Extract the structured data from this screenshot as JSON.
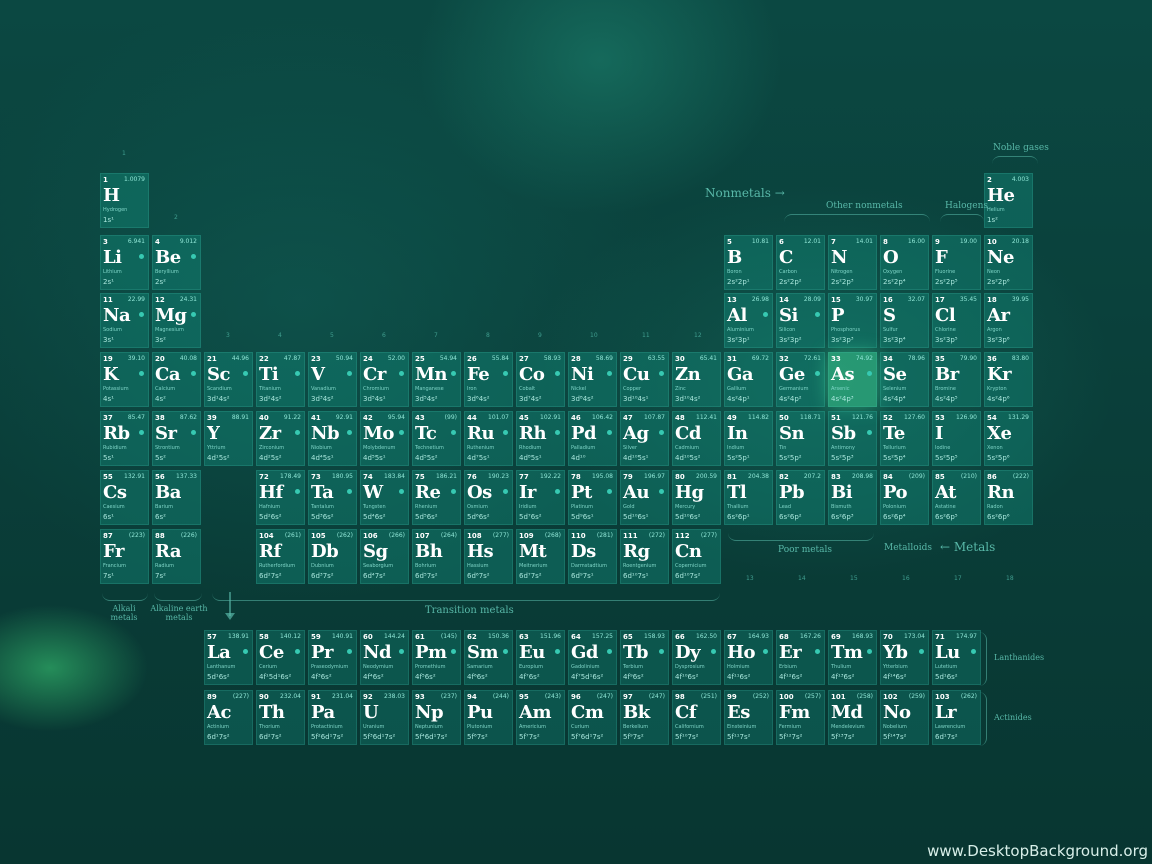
{
  "labels": {
    "nonmetals": "Nonmetals →",
    "other_nonmetals": "Other nonmetals",
    "halogens": "Halogens",
    "noble_gases": "Noble gases",
    "transition_metals": "Transition metals",
    "alkali_metals": "Alkali metals",
    "alkaline_earth_metals": "Alkaline earth metals",
    "poor_metals": "Poor metals",
    "metalloids": "Metalloids",
    "metals": "← Metals",
    "lanthanides": "Lanthanides",
    "actinides": "Actinides"
  },
  "watermark": "www.DesktopBackground.org",
  "elements": [
    {
      "n": "1",
      "s": "H",
      "name": "Hydrogen",
      "m": "1.0079",
      "c": "1s¹",
      "col": 1,
      "row": 1
    },
    {
      "n": "2",
      "s": "He",
      "name": "Helium",
      "m": "4.003",
      "c": "1s²",
      "col": 18,
      "row": 1
    },
    {
      "n": "3",
      "s": "Li",
      "name": "Lithium",
      "m": "6.941",
      "c": "2s¹",
      "col": 1,
      "row": 2
    },
    {
      "n": "4",
      "s": "Be",
      "name": "Beryllium",
      "m": "9.012",
      "c": "2s²",
      "col": 2,
      "row": 2
    },
    {
      "n": "5",
      "s": "B",
      "name": "Boron",
      "m": "10.81",
      "c": "2s²2p¹",
      "col": 13,
      "row": 2
    },
    {
      "n": "6",
      "s": "C",
      "name": "Carbon",
      "m": "12.01",
      "c": "2s²2p²",
      "col": 14,
      "row": 2
    },
    {
      "n": "7",
      "s": "N",
      "name": "Nitrogen",
      "m": "14.01",
      "c": "2s²2p³",
      "col": 15,
      "row": 2
    },
    {
      "n": "8",
      "s": "O",
      "name": "Oxygen",
      "m": "16.00",
      "c": "2s²2p⁴",
      "col": 16,
      "row": 2
    },
    {
      "n": "9",
      "s": "F",
      "name": "Fluorine",
      "m": "19.00",
      "c": "2s²2p⁵",
      "col": 17,
      "row": 2
    },
    {
      "n": "10",
      "s": "Ne",
      "name": "Neon",
      "m": "20.18",
      "c": "2s²2p⁶",
      "col": 18,
      "row": 2
    },
    {
      "n": "11",
      "s": "Na",
      "name": "Sodium",
      "m": "22.99",
      "c": "3s¹",
      "col": 1,
      "row": 3
    },
    {
      "n": "12",
      "s": "Mg",
      "name": "Magnesium",
      "m": "24.31",
      "c": "3s²",
      "col": 2,
      "row": 3
    },
    {
      "n": "13",
      "s": "Al",
      "name": "Aluminium",
      "m": "26.98",
      "c": "3s²3p¹",
      "col": 13,
      "row": 3
    },
    {
      "n": "14",
      "s": "Si",
      "name": "Silicon",
      "m": "28.09",
      "c": "3s²3p²",
      "col": 14,
      "row": 3
    },
    {
      "n": "15",
      "s": "P",
      "name": "Phosphorus",
      "m": "30.97",
      "c": "3s²3p³",
      "col": 15,
      "row": 3
    },
    {
      "n": "16",
      "s": "S",
      "name": "Sulfur",
      "m": "32.07",
      "c": "3s²3p⁴",
      "col": 16,
      "row": 3
    },
    {
      "n": "17",
      "s": "Cl",
      "name": "Chlorine",
      "m": "35.45",
      "c": "3s²3p⁵",
      "col": 17,
      "row": 3
    },
    {
      "n": "18",
      "s": "Ar",
      "name": "Argon",
      "m": "39.95",
      "c": "3s²3p⁶",
      "col": 18,
      "row": 3
    },
    {
      "n": "19",
      "s": "K",
      "name": "Potassium",
      "m": "39.10",
      "c": "4s¹",
      "col": 1,
      "row": 4
    },
    {
      "n": "20",
      "s": "Ca",
      "name": "Calcium",
      "m": "40.08",
      "c": "4s²",
      "col": 2,
      "row": 4
    },
    {
      "n": "21",
      "s": "Sc",
      "name": "Scandium",
      "m": "44.96",
      "c": "3d¹4s²",
      "col": 3,
      "row": 4
    },
    {
      "n": "22",
      "s": "Ti",
      "name": "Titanium",
      "m": "47.87",
      "c": "3d²4s²",
      "col": 4,
      "row": 4
    },
    {
      "n": "23",
      "s": "V",
      "name": "Vanadium",
      "m": "50.94",
      "c": "3d³4s²",
      "col": 5,
      "row": 4
    },
    {
      "n": "24",
      "s": "Cr",
      "name": "Chromium",
      "m": "52.00",
      "c": "3d⁵4s¹",
      "col": 6,
      "row": 4
    },
    {
      "n": "25",
      "s": "Mn",
      "name": "Manganese",
      "m": "54.94",
      "c": "3d⁵4s²",
      "col": 7,
      "row": 4
    },
    {
      "n": "26",
      "s": "Fe",
      "name": "Iron",
      "m": "55.84",
      "c": "3d⁶4s²",
      "col": 8,
      "row": 4
    },
    {
      "n": "27",
      "s": "Co",
      "name": "Cobalt",
      "m": "58.93",
      "c": "3d⁷4s²",
      "col": 9,
      "row": 4
    },
    {
      "n": "28",
      "s": "Ni",
      "name": "Nickel",
      "m": "58.69",
      "c": "3d⁸4s²",
      "col": 10,
      "row": 4
    },
    {
      "n": "29",
      "s": "Cu",
      "name": "Copper",
      "m": "63.55",
      "c": "3d¹⁰4s¹",
      "col": 11,
      "row": 4
    },
    {
      "n": "30",
      "s": "Zn",
      "name": "Zinc",
      "m": "65.41",
      "c": "3d¹⁰4s²",
      "col": 12,
      "row": 4
    },
    {
      "n": "31",
      "s": "Ga",
      "name": "Gallium",
      "m": "69.72",
      "c": "4s²4p¹",
      "col": 13,
      "row": 4
    },
    {
      "n": "32",
      "s": "Ge",
      "name": "Germanium",
      "m": "72.61",
      "c": "4s²4p²",
      "col": 14,
      "row": 4
    },
    {
      "n": "33",
      "s": "As",
      "name": "Arsenic",
      "m": "74.92",
      "c": "4s²4p³",
      "col": 15,
      "row": 4,
      "hl": true
    },
    {
      "n": "34",
      "s": "Se",
      "name": "Selenium",
      "m": "78.96",
      "c": "4s²4p⁴",
      "col": 16,
      "row": 4
    },
    {
      "n": "35",
      "s": "Br",
      "name": "Bromine",
      "m": "79.90",
      "c": "4s²4p⁵",
      "col": 17,
      "row": 4
    },
    {
      "n": "36",
      "s": "Kr",
      "name": "Krypton",
      "m": "83.80",
      "c": "4s²4p⁶",
      "col": 18,
      "row": 4
    },
    {
      "n": "37",
      "s": "Rb",
      "name": "Rubidium",
      "m": "85.47",
      "c": "5s¹",
      "col": 1,
      "row": 5
    },
    {
      "n": "38",
      "s": "Sr",
      "name": "Strontium",
      "m": "87.62",
      "c": "5s²",
      "col": 2,
      "row": 5
    },
    {
      "n": "39",
      "s": "Y",
      "name": "Yttrium",
      "m": "88.91",
      "c": "4d¹5s²",
      "col": 3,
      "row": 5
    },
    {
      "n": "40",
      "s": "Zr",
      "name": "Zirconium",
      "m": "91.22",
      "c": "4d²5s²",
      "col": 4,
      "row": 5
    },
    {
      "n": "41",
      "s": "Nb",
      "name": "Niobium",
      "m": "92.91",
      "c": "4d⁴5s¹",
      "col": 5,
      "row": 5
    },
    {
      "n": "42",
      "s": "Mo",
      "name": "Molybdenum",
      "m": "95.94",
      "c": "4d⁵5s¹",
      "col": 6,
      "row": 5
    },
    {
      "n": "43",
      "s": "Tc",
      "name": "Technetium",
      "m": "(99)",
      "c": "4d⁵5s²",
      "col": 7,
      "row": 5
    },
    {
      "n": "44",
      "s": "Ru",
      "name": "Ruthenium",
      "m": "101.07",
      "c": "4d⁷5s¹",
      "col": 8,
      "row": 5
    },
    {
      "n": "45",
      "s": "Rh",
      "name": "Rhodium",
      "m": "102.91",
      "c": "4d⁸5s¹",
      "col": 9,
      "row": 5
    },
    {
      "n": "46",
      "s": "Pd",
      "name": "Palladium",
      "m": "106.42",
      "c": "4d¹⁰",
      "col": 10,
      "row": 5
    },
    {
      "n": "47",
      "s": "Ag",
      "name": "Silver",
      "m": "107.87",
      "c": "4d¹⁰5s¹",
      "col": 11,
      "row": 5
    },
    {
      "n": "48",
      "s": "Cd",
      "name": "Cadmium",
      "m": "112.41",
      "c": "4d¹⁰5s²",
      "col": 12,
      "row": 5
    },
    {
      "n": "49",
      "s": "In",
      "name": "Indium",
      "m": "114.82",
      "c": "5s²5p¹",
      "col": 13,
      "row": 5
    },
    {
      "n": "50",
      "s": "Sn",
      "name": "Tin",
      "m": "118.71",
      "c": "5s²5p²",
      "col": 14,
      "row": 5
    },
    {
      "n": "51",
      "s": "Sb",
      "name": "Antimony",
      "m": "121.76",
      "c": "5s²5p³",
      "col": 15,
      "row": 5
    },
    {
      "n": "52",
      "s": "Te",
      "name": "Tellurium",
      "m": "127.60",
      "c": "5s²5p⁴",
      "col": 16,
      "row": 5
    },
    {
      "n": "53",
      "s": "I",
      "name": "Iodine",
      "m": "126.90",
      "c": "5s²5p⁵",
      "col": 17,
      "row": 5
    },
    {
      "n": "54",
      "s": "Xe",
      "name": "Xenon",
      "m": "131.29",
      "c": "5s²5p⁶",
      "col": 18,
      "row": 5
    },
    {
      "n": "55",
      "s": "Cs",
      "name": "Caesium",
      "m": "132.91",
      "c": "6s¹",
      "col": 1,
      "row": 6
    },
    {
      "n": "56",
      "s": "Ba",
      "name": "Barium",
      "m": "137.33",
      "c": "6s²",
      "col": 2,
      "row": 6
    },
    {
      "n": "72",
      "s": "Hf",
      "name": "Hafnium",
      "m": "178.49",
      "c": "5d²6s²",
      "col": 4,
      "row": 6
    },
    {
      "n": "73",
      "s": "Ta",
      "name": "Tantalum",
      "m": "180.95",
      "c": "5d³6s²",
      "col": 5,
      "row": 6
    },
    {
      "n": "74",
      "s": "W",
      "name": "Tungsten",
      "m": "183.84",
      "c": "5d⁴6s²",
      "col": 6,
      "row": 6
    },
    {
      "n": "75",
      "s": "Re",
      "name": "Rhenium",
      "m": "186.21",
      "c": "5d⁵6s²",
      "col": 7,
      "row": 6
    },
    {
      "n": "76",
      "s": "Os",
      "name": "Osmium",
      "m": "190.23",
      "c": "5d⁶6s²",
      "col": 8,
      "row": 6
    },
    {
      "n": "77",
      "s": "Ir",
      "name": "Iridium",
      "m": "192.22",
      "c": "5d⁷6s²",
      "col": 9,
      "row": 6
    },
    {
      "n": "78",
      "s": "Pt",
      "name": "Platinum",
      "m": "195.08",
      "c": "5d⁹6s¹",
      "col": 10,
      "row": 6
    },
    {
      "n": "79",
      "s": "Au",
      "name": "Gold",
      "m": "196.97",
      "c": "5d¹⁰6s¹",
      "col": 11,
      "row": 6
    },
    {
      "n": "80",
      "s": "Hg",
      "name": "Mercury",
      "m": "200.59",
      "c": "5d¹⁰6s²",
      "col": 12,
      "row": 6
    },
    {
      "n": "81",
      "s": "Tl",
      "name": "Thallium",
      "m": "204.38",
      "c": "6s²6p¹",
      "col": 13,
      "row": 6
    },
    {
      "n": "82",
      "s": "Pb",
      "name": "Lead",
      "m": "207.2",
      "c": "6s²6p²",
      "col": 14,
      "row": 6
    },
    {
      "n": "83",
      "s": "Bi",
      "name": "Bismuth",
      "m": "208.98",
      "c": "6s²6p³",
      "col": 15,
      "row": 6
    },
    {
      "n": "84",
      "s": "Po",
      "name": "Polonium",
      "m": "(209)",
      "c": "6s²6p⁴",
      "col": 16,
      "row": 6
    },
    {
      "n": "85",
      "s": "At",
      "name": "Astatine",
      "m": "(210)",
      "c": "6s²6p⁵",
      "col": 17,
      "row": 6
    },
    {
      "n": "86",
      "s": "Rn",
      "name": "Radon",
      "m": "(222)",
      "c": "6s²6p⁶",
      "col": 18,
      "row": 6
    },
    {
      "n": "87",
      "s": "Fr",
      "name": "Francium",
      "m": "(223)",
      "c": "7s¹",
      "col": 1,
      "row": 7
    },
    {
      "n": "88",
      "s": "Ra",
      "name": "Radium",
      "m": "(226)",
      "c": "7s²",
      "col": 2,
      "row": 7
    },
    {
      "n": "104",
      "s": "Rf",
      "name": "Rutherfordium",
      "m": "(261)",
      "c": "6d²7s²",
      "col": 4,
      "row": 7
    },
    {
      "n": "105",
      "s": "Db",
      "name": "Dubnium",
      "m": "(262)",
      "c": "6d³7s²",
      "col": 5,
      "row": 7
    },
    {
      "n": "106",
      "s": "Sg",
      "name": "Seaborgium",
      "m": "(266)",
      "c": "6d⁴7s²",
      "col": 6,
      "row": 7
    },
    {
      "n": "107",
      "s": "Bh",
      "name": "Bohrium",
      "m": "(264)",
      "c": "6d⁵7s²",
      "col": 7,
      "row": 7
    },
    {
      "n": "108",
      "s": "Hs",
      "name": "Hassium",
      "m": "(277)",
      "c": "6d⁶7s²",
      "col": 8,
      "row": 7
    },
    {
      "n": "109",
      "s": "Mt",
      "name": "Meitnerium",
      "m": "(268)",
      "c": "6d⁷7s²",
      "col": 9,
      "row": 7
    },
    {
      "n": "110",
      "s": "Ds",
      "name": "Darmstadtium",
      "m": "(281)",
      "c": "6d⁹7s¹",
      "col": 10,
      "row": 7
    },
    {
      "n": "111",
      "s": "Rg",
      "name": "Roentgenium",
      "m": "(272)",
      "c": "6d¹⁰7s¹",
      "col": 11,
      "row": 7
    },
    {
      "n": "112",
      "s": "Cn",
      "name": "Copernicium",
      "m": "(277)",
      "c": "6d¹⁰7s²",
      "col": 12,
      "row": 7
    },
    {
      "n": "57",
      "s": "La",
      "name": "Lanthanum",
      "m": "138.91",
      "c": "5d¹6s²",
      "col": 3,
      "row": 8
    },
    {
      "n": "58",
      "s": "Ce",
      "name": "Cerium",
      "m": "140.12",
      "c": "4f¹5d¹6s²",
      "col": 4,
      "row": 8
    },
    {
      "n": "59",
      "s": "Pr",
      "name": "Praseodymium",
      "m": "140.91",
      "c": "4f³6s²",
      "col": 5,
      "row": 8
    },
    {
      "n": "60",
      "s": "Nd",
      "name": "Neodymium",
      "m": "144.24",
      "c": "4f⁴6s²",
      "col": 6,
      "row": 8
    },
    {
      "n": "61",
      "s": "Pm",
      "name": "Promethium",
      "m": "(145)",
      "c": "4f⁵6s²",
      "col": 7,
      "row": 8
    },
    {
      "n": "62",
      "s": "Sm",
      "name": "Samarium",
      "m": "150.36",
      "c": "4f⁶6s²",
      "col": 8,
      "row": 8
    },
    {
      "n": "63",
      "s": "Eu",
      "name": "Europium",
      "m": "151.96",
      "c": "4f⁷6s²",
      "col": 9,
      "row": 8
    },
    {
      "n": "64",
      "s": "Gd",
      "name": "Gadolinium",
      "m": "157.25",
      "c": "4f⁷5d¹6s²",
      "col": 10,
      "row": 8
    },
    {
      "n": "65",
      "s": "Tb",
      "name": "Terbium",
      "m": "158.93",
      "c": "4f⁹6s²",
      "col": 11,
      "row": 8
    },
    {
      "n": "66",
      "s": "Dy",
      "name": "Dysprosium",
      "m": "162.50",
      "c": "4f¹⁰6s²",
      "col": 12,
      "row": 8
    },
    {
      "n": "67",
      "s": "Ho",
      "name": "Holmium",
      "m": "164.93",
      "c": "4f¹¹6s²",
      "col": 13,
      "row": 8
    },
    {
      "n": "68",
      "s": "Er",
      "name": "Erbium",
      "m": "167.26",
      "c": "4f¹²6s²",
      "col": 14,
      "row": 8
    },
    {
      "n": "69",
      "s": "Tm",
      "name": "Thulium",
      "m": "168.93",
      "c": "4f¹³6s²",
      "col": 15,
      "row": 8
    },
    {
      "n": "70",
      "s": "Yb",
      "name": "Ytterbium",
      "m": "173.04",
      "c": "4f¹⁴6s²",
      "col": 16,
      "row": 8
    },
    {
      "n": "71",
      "s": "Lu",
      "name": "Lutetium",
      "m": "174.97",
      "c": "5d¹6s²",
      "col": 17,
      "row": 8
    },
    {
      "n": "89",
      "s": "Ac",
      "name": "Actinium",
      "m": "(227)",
      "c": "6d¹7s²",
      "col": 3,
      "row": 9
    },
    {
      "n": "90",
      "s": "Th",
      "name": "Thorium",
      "m": "232.04",
      "c": "6d²7s²",
      "col": 4,
      "row": 9
    },
    {
      "n": "91",
      "s": "Pa",
      "name": "Protactinium",
      "m": "231.04",
      "c": "5f²6d¹7s²",
      "col": 5,
      "row": 9
    },
    {
      "n": "92",
      "s": "U",
      "name": "Uranium",
      "m": "238.03",
      "c": "5f³6d¹7s²",
      "col": 6,
      "row": 9
    },
    {
      "n": "93",
      "s": "Np",
      "name": "Neptunium",
      "m": "(237)",
      "c": "5f⁴6d¹7s²",
      "col": 7,
      "row": 9
    },
    {
      "n": "94",
      "s": "Pu",
      "name": "Plutonium",
      "m": "(244)",
      "c": "5f⁶7s²",
      "col": 8,
      "row": 9
    },
    {
      "n": "95",
      "s": "Am",
      "name": "Americium",
      "m": "(243)",
      "c": "5f⁷7s²",
      "col": 9,
      "row": 9
    },
    {
      "n": "96",
      "s": "Cm",
      "name": "Curium",
      "m": "(247)",
      "c": "5f⁷6d¹7s²",
      "col": 10,
      "row": 9
    },
    {
      "n": "97",
      "s": "Bk",
      "name": "Berkelium",
      "m": "(247)",
      "c": "5f⁹7s²",
      "col": 11,
      "row": 9
    },
    {
      "n": "98",
      "s": "Cf",
      "name": "Californium",
      "m": "(251)",
      "c": "5f¹⁰7s²",
      "col": 12,
      "row": 9
    },
    {
      "n": "99",
      "s": "Es",
      "name": "Einsteinium",
      "m": "(252)",
      "c": "5f¹¹7s²",
      "col": 13,
      "row": 9
    },
    {
      "n": "100",
      "s": "Fm",
      "name": "Fermium",
      "m": "(257)",
      "c": "5f¹²7s²",
      "col": 14,
      "row": 9
    },
    {
      "n": "101",
      "s": "Md",
      "name": "Mendelevium",
      "m": "(258)",
      "c": "5f¹³7s²",
      "col": 15,
      "row": 9
    },
    {
      "n": "102",
      "s": "No",
      "name": "Nobelium",
      "m": "(259)",
      "c": "5f¹⁴7s²",
      "col": 16,
      "row": 9
    },
    {
      "n": "103",
      "s": "Lr",
      "name": "Lawrencium",
      "m": "(262)",
      "c": "6d¹7s²",
      "col": 17,
      "row": 9
    }
  ],
  "group_numbers": [
    "1",
    "2",
    "3",
    "4",
    "5",
    "6",
    "7",
    "8",
    "9",
    "10",
    "11",
    "12",
    "13",
    "14",
    "15",
    "16",
    "17",
    "18"
  ]
}
